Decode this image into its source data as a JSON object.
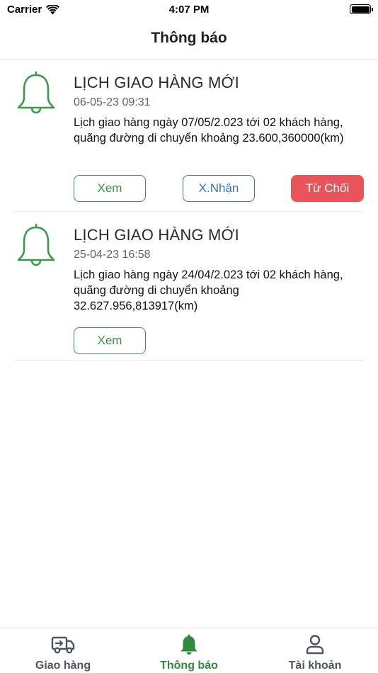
{
  "status_bar": {
    "carrier": "Carrier",
    "time": "4:07 PM"
  },
  "header": {
    "title": "Thông báo"
  },
  "notifications": [
    {
      "title": "LỊCH GIAO HÀNG MỚI",
      "date": "06-05-23 09:31",
      "body": "Lịch giao hàng ngày 07/05/2.023 tới   02 khách hàng, quãng đường di chuyển khoảng 23.600,360000(km)",
      "view_label": "Xem",
      "accept_label": "X.Nhận",
      "reject_label": "Từ Chối"
    },
    {
      "title": "LỊCH GIAO HÀNG MỚI",
      "date": "25-04-23 16:58",
      "body": "Lịch giao hàng ngày 24/04/2.023 tới   02 khách hàng, quãng đường di chuyển khoảng 32.627.956,813917(km)",
      "view_label": "Xem"
    }
  ],
  "tabs": [
    {
      "label": "Giao hàng",
      "icon": "delivery-truck-icon"
    },
    {
      "label": "Thông báo",
      "icon": "bell-icon",
      "active": true
    },
    {
      "label": "Tài khoản",
      "icon": "user-icon"
    }
  ],
  "colors": {
    "accent_green": "#2e8b3e",
    "accept_blue": "#3670c9",
    "reject_red": "#e9545a"
  }
}
